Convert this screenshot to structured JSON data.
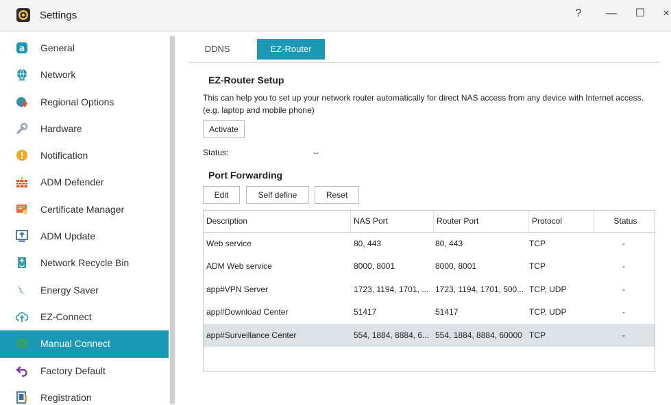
{
  "window": {
    "title": "Settings",
    "controls": {
      "help": "?",
      "minimize": "—",
      "maximize": "☐",
      "close": "×"
    }
  },
  "sidebar": {
    "items": [
      {
        "label": "General",
        "icon": "general-icon",
        "color": "#1a98b4"
      },
      {
        "label": "Network",
        "icon": "globe-icon",
        "color": "#1a98b4"
      },
      {
        "label": "Regional Options",
        "icon": "regional-pin-icon",
        "color": "#2d8fc6"
      },
      {
        "label": "Hardware",
        "icon": "hardware-wrench-icon",
        "color": "#9aa5b5"
      },
      {
        "label": "Notification",
        "icon": "notification-icon",
        "color": "#f4a81d"
      },
      {
        "label": "ADM Defender",
        "icon": "firewall-icon",
        "color": "#e2562e"
      },
      {
        "label": "Certificate Manager",
        "icon": "certificate-icon",
        "color": "#e96a3b"
      },
      {
        "label": "ADM Update",
        "icon": "update-icon",
        "color": "#3f6ea3"
      },
      {
        "label": "Network Recycle Bin",
        "icon": "recycle-bin-icon",
        "color": "#3f9fa0"
      },
      {
        "label": "Energy Saver",
        "icon": "energy-icon",
        "color": "#3aa35a"
      },
      {
        "label": "EZ-Connect",
        "icon": "cloud-upload-icon",
        "color": "#1a98b4"
      },
      {
        "label": "Manual Connect",
        "icon": "manual-connect-icon",
        "color": "#3aa35a",
        "active": true
      },
      {
        "label": "Factory Default",
        "icon": "undo-arrow-icon",
        "color": "#7b3fa8"
      },
      {
        "label": "Registration",
        "icon": "registration-icon",
        "color": "#3f6ea3"
      }
    ]
  },
  "tabs": [
    {
      "label": "DDNS",
      "active": false
    },
    {
      "label": "EZ-Router",
      "active": true
    }
  ],
  "setup": {
    "title": "EZ-Router Setup",
    "description": "This can help you to set up your network router automatically for direct NAS access from any device with Internet access. (e.g. laptop and mobile phone)",
    "activate_label": "Activate",
    "status_label": "Status:",
    "status_value": "--"
  },
  "port_forwarding": {
    "title": "Port Forwarding",
    "buttons": {
      "edit": "Edit",
      "self_define": "Self define",
      "reset": "Reset"
    },
    "columns": [
      "Description",
      "NAS Port",
      "Router Port",
      "Protocol",
      "Status"
    ],
    "rows": [
      {
        "description": "Web service",
        "nas_port": "80, 443",
        "router_port": "80, 443",
        "protocol": "TCP",
        "status": "-"
      },
      {
        "description": "ADM Web service",
        "nas_port": "8000, 8001",
        "router_port": "8000, 8001",
        "protocol": "TCP",
        "status": "-"
      },
      {
        "description": "app#VPN Server",
        "nas_port": "1723, 1194, 1701, ...",
        "router_port": "1723, 1194, 1701, 500...",
        "protocol": "TCP, UDP",
        "status": "-"
      },
      {
        "description": "app#Download Center",
        "nas_port": "51417",
        "router_port": "51417",
        "protocol": "TCP, UDP",
        "status": "-"
      },
      {
        "description": "app#Surveillance Center",
        "nas_port": "554, 1884, 8884, 6...",
        "router_port": "554, 1884, 8884, 60000",
        "protocol": "TCP",
        "status": "-",
        "selected": true
      }
    ]
  },
  "colors": {
    "accent": "#1a98b4",
    "selected_row": "#dde2e7",
    "border": "#c8c8c8"
  }
}
